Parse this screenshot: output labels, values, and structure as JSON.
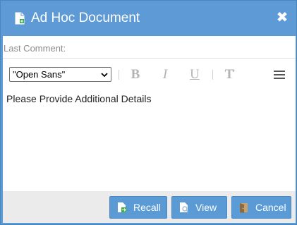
{
  "window": {
    "title": "Ad Hoc Document",
    "close_symbol": "✖"
  },
  "comment": {
    "label": "Last Comment:"
  },
  "toolbar": {
    "font_value": "\"Open Sans\"",
    "bold": "B",
    "italic": "I",
    "underline": "U",
    "text_size": "T",
    "menu_icon": "hamburger-menu-icon"
  },
  "editor": {
    "content": "Please Provide Additional Details"
  },
  "footer": {
    "recall_label": "Recall",
    "view_label": "View",
    "cancel_label": "Cancel"
  },
  "colors": {
    "title_bar": "#5d9ad6",
    "button": "#5b9bd5",
    "footer": "#ebebeb"
  }
}
